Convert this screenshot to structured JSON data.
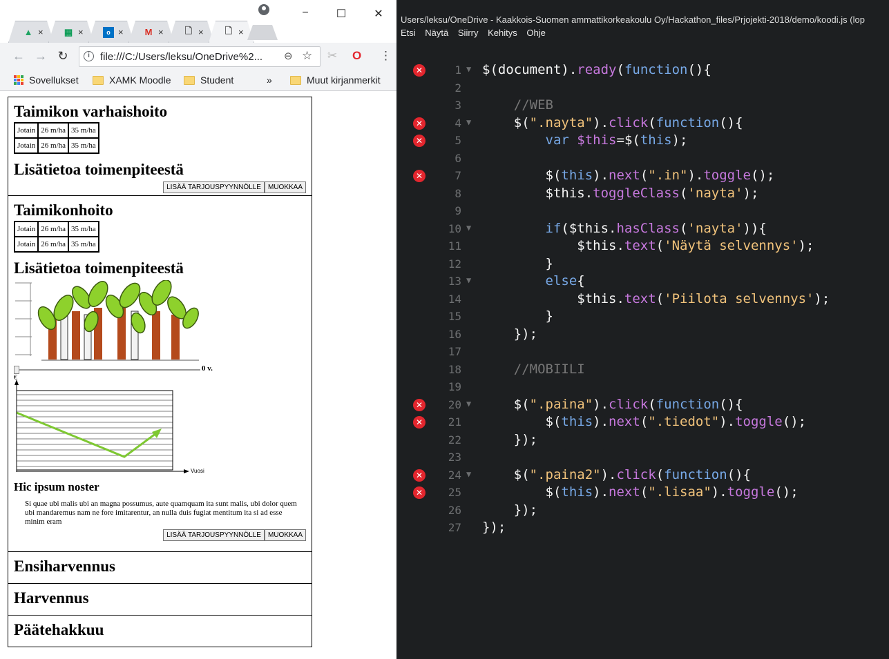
{
  "browser": {
    "tabs": [
      {
        "icon": "google-drive-icon",
        "close": "×"
      },
      {
        "icon": "google-sheets-icon",
        "close": "×"
      },
      {
        "icon": "outlook-icon",
        "close": "×"
      },
      {
        "icon": "gmail-icon",
        "close": "×"
      },
      {
        "icon": "page-icon",
        "close": "×"
      },
      {
        "icon": "page-icon",
        "close": "×"
      }
    ],
    "window_controls": {
      "minimize": "−",
      "maximize": "☐",
      "close": "✕"
    },
    "url": "file:///C:/Users/leksu/OneDrive%2...",
    "bookmarks": {
      "apps": "Sovellukset",
      "items": [
        "XAMK Moodle",
        "Student"
      ],
      "more": "»",
      "other": "Muut kirjanmerkit"
    }
  },
  "page": {
    "sections": [
      {
        "title": "Taimikon varhaishoito",
        "table": [
          [
            "Jotain",
            "26 m/ha",
            "35 m/ha"
          ],
          [
            "Jotain",
            "26 m/ha",
            "35 m/ha"
          ]
        ],
        "info_title": "Lisätietoa toimenpiteestä",
        "add_button": "LISÄÄ TARJOUSPYYNNÖLLE",
        "edit_button": "MUOKKAA"
      },
      {
        "title": "Taimikonhoito",
        "table": [
          [
            "Jotain",
            "26 m/ha",
            "35 m/ha"
          ],
          [
            "Jotain",
            "26 m/ha",
            "35 m/ha"
          ]
        ],
        "info_title": "Lisätietoa toimenpiteestä",
        "slider_value": "0 v.",
        "chart_y_label": "€",
        "chart_x_label": "Vuosi",
        "subheading": "Hic ipsum noster",
        "paragraph": "Si quae ubi malis ubi an magna possumus, aute quamquam ita sunt malis, ubi dolor quem ubi mandaremus nam ne fore imitarentur, an nulla duis fugiat mentitum ita si ad esse minim eram",
        "add_button": "LISÄÄ TARJOUSPYYNNÖLLE",
        "edit_button": "MUOKKAA"
      }
    ],
    "collapsed_sections": [
      "Ensiharvennus",
      "Harvennus",
      "Päätehakkuu"
    ]
  },
  "editor": {
    "title": "Users/leksu/OneDrive - Kaakkois-Suomen ammattikorkeakoulu Oy/Hackathon_files/Prjojekti-2018/demo/koodi.js (lop",
    "menu": [
      "Etsi",
      "Näytä",
      "Siirry",
      "Kehitys",
      "Ohje"
    ],
    "lines": [
      {
        "n": "1",
        "err": true,
        "fold": true,
        "tokens": [
          [
            "pl",
            "$(document)."
          ],
          [
            "fn",
            "ready"
          ],
          [
            "pl",
            "("
          ],
          [
            "kw",
            "function"
          ],
          [
            "pl",
            "(){"
          ]
        ]
      },
      {
        "n": "2",
        "err": false,
        "fold": false,
        "tokens": []
      },
      {
        "n": "3",
        "err": false,
        "fold": false,
        "tokens": [
          [
            "pl",
            "    "
          ],
          [
            "cm",
            "//WEB"
          ]
        ]
      },
      {
        "n": "4",
        "err": true,
        "fold": true,
        "tokens": [
          [
            "pl",
            "    $("
          ],
          [
            "str",
            "\".nayta\""
          ],
          [
            "pl",
            ")."
          ],
          [
            "fn",
            "click"
          ],
          [
            "pl",
            "("
          ],
          [
            "kw",
            "function"
          ],
          [
            "pl",
            "(){"
          ]
        ]
      },
      {
        "n": "5",
        "err": true,
        "fold": false,
        "tokens": [
          [
            "pl",
            "        "
          ],
          [
            "kw",
            "var"
          ],
          [
            "pl",
            " "
          ],
          [
            "fn",
            "$this"
          ],
          [
            "pl",
            "=$("
          ],
          [
            "kw",
            "this"
          ],
          [
            "pl",
            ");"
          ]
        ]
      },
      {
        "n": "6",
        "err": false,
        "fold": false,
        "tokens": []
      },
      {
        "n": "7",
        "err": true,
        "fold": false,
        "tokens": [
          [
            "pl",
            "        $("
          ],
          [
            "kw",
            "this"
          ],
          [
            "pl",
            ")."
          ],
          [
            "fn",
            "next"
          ],
          [
            "pl",
            "("
          ],
          [
            "str",
            "\".in\""
          ],
          [
            "pl",
            ")."
          ],
          [
            "fn",
            "toggle"
          ],
          [
            "pl",
            "();"
          ]
        ]
      },
      {
        "n": "8",
        "err": false,
        "fold": false,
        "tokens": [
          [
            "pl",
            "        $this."
          ],
          [
            "fn",
            "toggleClass"
          ],
          [
            "pl",
            "("
          ],
          [
            "str",
            "'nayta'"
          ],
          [
            "pl",
            ");"
          ]
        ]
      },
      {
        "n": "9",
        "err": false,
        "fold": false,
        "tokens": []
      },
      {
        "n": "10",
        "err": false,
        "fold": true,
        "tokens": [
          [
            "pl",
            "        "
          ],
          [
            "kw",
            "if"
          ],
          [
            "pl",
            "($this."
          ],
          [
            "fn",
            "hasClass"
          ],
          [
            "pl",
            "("
          ],
          [
            "str",
            "'nayta'"
          ],
          [
            "pl",
            "))"
          ],
          [
            "pl",
            "{"
          ]
        ]
      },
      {
        "n": "11",
        "err": false,
        "fold": false,
        "tokens": [
          [
            "pl",
            "            $this."
          ],
          [
            "fn",
            "text"
          ],
          [
            "pl",
            "("
          ],
          [
            "str",
            "'Näytä selvennys'"
          ],
          [
            "pl",
            ");"
          ]
        ]
      },
      {
        "n": "12",
        "err": false,
        "fold": false,
        "tokens": [
          [
            "pl",
            "        }"
          ]
        ]
      },
      {
        "n": "13",
        "err": false,
        "fold": true,
        "tokens": [
          [
            "pl",
            "        "
          ],
          [
            "kw",
            "else"
          ],
          [
            "pl",
            "{"
          ]
        ]
      },
      {
        "n": "14",
        "err": false,
        "fold": false,
        "tokens": [
          [
            "pl",
            "            $this."
          ],
          [
            "fn",
            "text"
          ],
          [
            "pl",
            "("
          ],
          [
            "str",
            "'Piilota selvennys'"
          ],
          [
            "pl",
            ");"
          ]
        ]
      },
      {
        "n": "15",
        "err": false,
        "fold": false,
        "tokens": [
          [
            "pl",
            "        }"
          ]
        ]
      },
      {
        "n": "16",
        "err": false,
        "fold": false,
        "tokens": [
          [
            "pl",
            "    });"
          ]
        ]
      },
      {
        "n": "17",
        "err": false,
        "fold": false,
        "tokens": []
      },
      {
        "n": "18",
        "err": false,
        "fold": false,
        "tokens": [
          [
            "pl",
            "    "
          ],
          [
            "cm",
            "//MOBIILI"
          ]
        ]
      },
      {
        "n": "19",
        "err": false,
        "fold": false,
        "tokens": []
      },
      {
        "n": "20",
        "err": true,
        "fold": true,
        "tokens": [
          [
            "pl",
            "    $("
          ],
          [
            "str",
            "\".paina\""
          ],
          [
            "pl",
            ")."
          ],
          [
            "fn",
            "click"
          ],
          [
            "pl",
            "("
          ],
          [
            "kw",
            "function"
          ],
          [
            "pl",
            "(){"
          ]
        ]
      },
      {
        "n": "21",
        "err": true,
        "fold": false,
        "tokens": [
          [
            "pl",
            "        $("
          ],
          [
            "kw",
            "this"
          ],
          [
            "pl",
            ")."
          ],
          [
            "fn",
            "next"
          ],
          [
            "pl",
            "("
          ],
          [
            "str",
            "\".tiedot\""
          ],
          [
            "pl",
            ")."
          ],
          [
            "fn",
            "toggle"
          ],
          [
            "pl",
            "();"
          ]
        ]
      },
      {
        "n": "22",
        "err": false,
        "fold": false,
        "tokens": [
          [
            "pl",
            "    });"
          ]
        ]
      },
      {
        "n": "23",
        "err": false,
        "fold": false,
        "tokens": []
      },
      {
        "n": "24",
        "err": true,
        "fold": true,
        "tokens": [
          [
            "pl",
            "    $("
          ],
          [
            "str",
            "\".paina2\""
          ],
          [
            "pl",
            ")."
          ],
          [
            "fn",
            "click"
          ],
          [
            "pl",
            "("
          ],
          [
            "kw",
            "function"
          ],
          [
            "pl",
            "(){"
          ]
        ]
      },
      {
        "n": "25",
        "err": true,
        "fold": false,
        "tokens": [
          [
            "pl",
            "        $("
          ],
          [
            "kw",
            "this"
          ],
          [
            "pl",
            ")."
          ],
          [
            "fn",
            "next"
          ],
          [
            "pl",
            "("
          ],
          [
            "str",
            "\".lisaa\""
          ],
          [
            "pl",
            ")."
          ],
          [
            "fn",
            "toggle"
          ],
          [
            "pl",
            "();"
          ]
        ]
      },
      {
        "n": "26",
        "err": false,
        "fold": false,
        "tokens": [
          [
            "pl",
            "    });"
          ]
        ]
      },
      {
        "n": "27",
        "err": false,
        "fold": false,
        "tokens": [
          [
            "pl",
            "});"
          ]
        ]
      }
    ]
  },
  "colors": {
    "editor_bg": "#1d1f21",
    "error": "#e3262e",
    "function": "#c678dd",
    "keyword": "#77a8e6",
    "string": "#f0c27b",
    "comment": "#767676",
    "chart_line": "#7ec832"
  }
}
